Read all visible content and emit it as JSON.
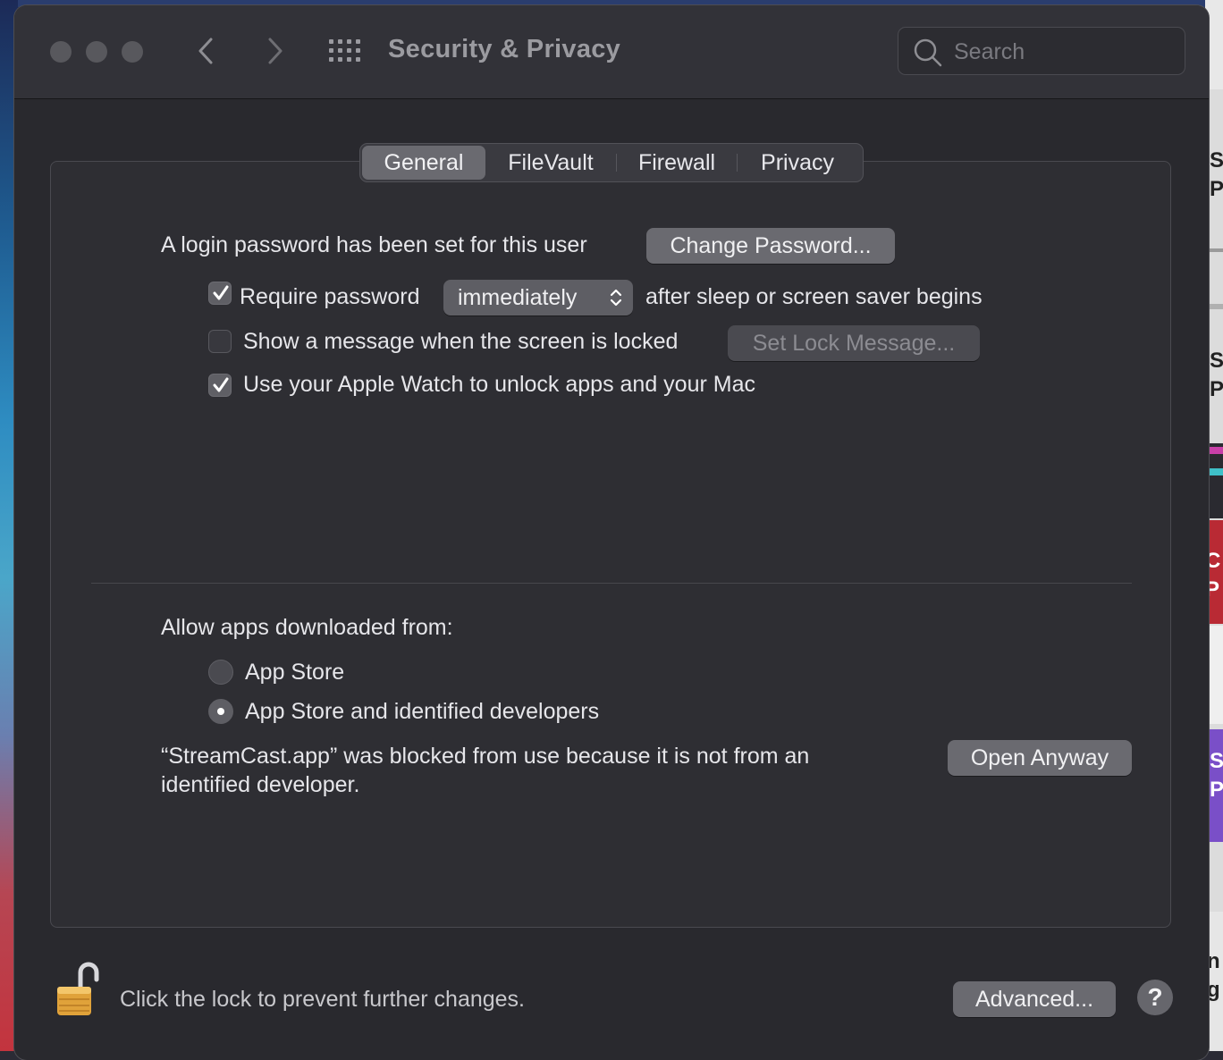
{
  "window": {
    "title": "Security & Privacy",
    "search_placeholder": "Search"
  },
  "tabs": [
    {
      "label": "General",
      "active": true
    },
    {
      "label": "FileVault",
      "active": false
    },
    {
      "label": "Firewall",
      "active": false
    },
    {
      "label": "Privacy",
      "active": false
    }
  ],
  "general": {
    "login_text": "A login password has been set for this user",
    "change_password_label": "Change Password...",
    "require_password": {
      "label": "Require password",
      "checked": true
    },
    "require_interval": "immediately",
    "require_suffix": "after sleep or screen saver begins",
    "show_message": {
      "label": "Show a message when the screen is locked",
      "checked": false
    },
    "set_lock_message_label": "Set Lock Message...",
    "apple_watch": {
      "label": "Use your Apple Watch to unlock apps and your Mac",
      "checked": true
    }
  },
  "allow_apps": {
    "heading": "Allow apps downloaded from:",
    "options": [
      {
        "label": "App Store",
        "selected": false
      },
      {
        "label": "App Store and identified developers",
        "selected": true
      }
    ],
    "blocked_message_line1": "“StreamCast.app” was blocked from use because it is not from an",
    "blocked_message_line2": "identified developer.",
    "open_anyway_label": "Open Anyway"
  },
  "footer": {
    "lock_text": "Click the lock to prevent further changes.",
    "advanced_label": "Advanced...",
    "help_label": "?"
  },
  "background_letters": [
    "S",
    "P",
    "S",
    "P",
    "C",
    "P",
    "S",
    "P",
    "n",
    "g"
  ]
}
